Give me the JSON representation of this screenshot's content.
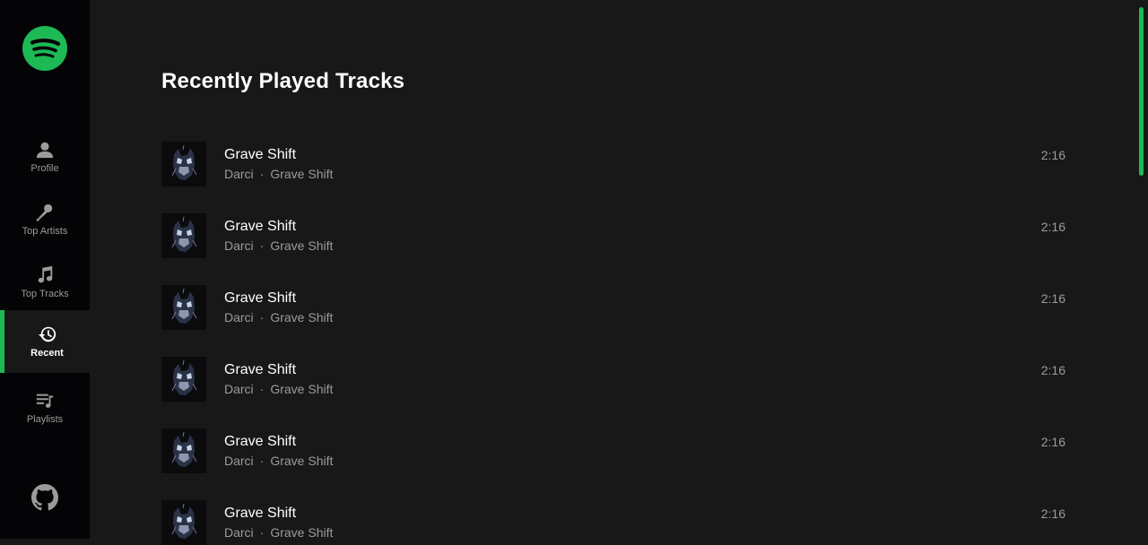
{
  "brand_color": "#1db954",
  "sidebar": {
    "logo_icon": "spotify-logo-icon",
    "items": [
      {
        "label": "Profile",
        "icon": "user-icon"
      },
      {
        "label": "Top Artists",
        "icon": "microphone-icon"
      },
      {
        "label": "Top Tracks",
        "icon": "music-note-icon"
      },
      {
        "label": "Recent",
        "icon": "history-icon",
        "active": true
      },
      {
        "label": "Playlists",
        "icon": "playlist-icon"
      }
    ],
    "footer_icon": "github-icon"
  },
  "main": {
    "title": "Recently Played Tracks",
    "tracks": [
      {
        "name": "Grave Shift",
        "artist": "Darci",
        "separator": "·",
        "album": "Grave Shift",
        "duration": "2:16"
      },
      {
        "name": "Grave Shift",
        "artist": "Darci",
        "separator": "·",
        "album": "Grave Shift",
        "duration": "2:16"
      },
      {
        "name": "Grave Shift",
        "artist": "Darci",
        "separator": "·",
        "album": "Grave Shift",
        "duration": "2:16"
      },
      {
        "name": "Grave Shift",
        "artist": "Darci",
        "separator": "·",
        "album": "Grave Shift",
        "duration": "2:16"
      },
      {
        "name": "Grave Shift",
        "artist": "Darci",
        "separator": "·",
        "album": "Grave Shift",
        "duration": "2:16"
      },
      {
        "name": "Grave Shift",
        "artist": "Darci",
        "separator": "·",
        "album": "Grave Shift",
        "duration": "2:16"
      }
    ]
  }
}
